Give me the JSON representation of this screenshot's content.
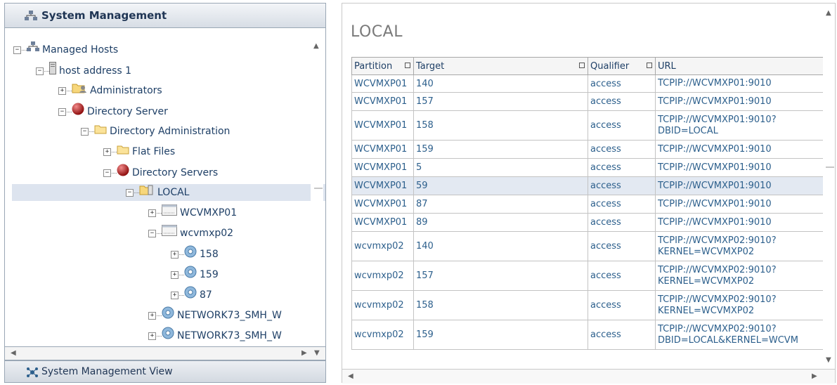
{
  "left_panel": {
    "header_title": "System Management",
    "footer_title": "System Management View",
    "tree": [
      {
        "label": "Managed Hosts",
        "icon": "hosts-icon",
        "toggle": "−"
      },
      {
        "label": "host address 1",
        "icon": "server-icon",
        "toggle": "−"
      },
      {
        "label": "Administrators",
        "icon": "admin-folder-icon",
        "toggle": "+"
      },
      {
        "label": "Directory Server",
        "icon": "red-ball-icon",
        "toggle": "−"
      },
      {
        "label": "Directory Administration",
        "icon": "folder-icon",
        "toggle": "−"
      },
      {
        "label": "Flat Files",
        "icon": "folder-icon",
        "toggle": "+"
      },
      {
        "label": "Directory Servers",
        "icon": "red-ball-icon",
        "toggle": "−"
      },
      {
        "label": "LOCAL",
        "icon": "local-folder-icon",
        "toggle": "−"
      },
      {
        "label": "WCVMXP01",
        "icon": "kernel-icon",
        "toggle": "+"
      },
      {
        "label": "wcvmxp02",
        "icon": "kernel-icon",
        "toggle": "−"
      },
      {
        "label": "158",
        "icon": "disc-icon",
        "toggle": "+"
      },
      {
        "label": "159",
        "icon": "disc-icon",
        "toggle": "+"
      },
      {
        "label": "87",
        "icon": "disc-icon",
        "toggle": "+"
      },
      {
        "label": "NETWORK73_SMH_W",
        "icon": "disc-icon",
        "toggle": "+"
      },
      {
        "label": "NETWORK73_SMH_W",
        "icon": "disc-icon",
        "toggle": "+"
      }
    ]
  },
  "right_panel": {
    "title": "LOCAL",
    "columns": [
      "Partition",
      "Target",
      "Qualifier",
      "URL"
    ],
    "rows": [
      {
        "partition": "WCVMXP01",
        "target": "140",
        "qualifier": "access",
        "url": "TCPIP://WCVMXP01:9010"
      },
      {
        "partition": "WCVMXP01",
        "target": "157",
        "qualifier": "access",
        "url": "TCPIP://WCVMXP01:9010"
      },
      {
        "partition": "WCVMXP01",
        "target": "158",
        "qualifier": "access",
        "url": "TCPIP://WCVMXP01:9010? DBID=LOCAL"
      },
      {
        "partition": "WCVMXP01",
        "target": "159",
        "qualifier": "access",
        "url": "TCPIP://WCVMXP01:9010"
      },
      {
        "partition": "WCVMXP01",
        "target": "5",
        "qualifier": "access",
        "url": "TCPIP://WCVMXP01:9010"
      },
      {
        "partition": "WCVMXP01",
        "target": "59",
        "qualifier": "access",
        "url": "TCPIP://WCVMXP01:9010"
      },
      {
        "partition": "WCVMXP01",
        "target": "87",
        "qualifier": "access",
        "url": "TCPIP://WCVMXP01:9010"
      },
      {
        "partition": "WCVMXP01",
        "target": "89",
        "qualifier": "access",
        "url": "TCPIP://WCVMXP01:9010"
      },
      {
        "partition": "wcvmxp02",
        "target": "140",
        "qualifier": "access",
        "url": "TCPIP://WCVMXP02:9010? KERNEL=WCVMXP02"
      },
      {
        "partition": "wcvmxp02",
        "target": "157",
        "qualifier": "access",
        "url": "TCPIP://WCVMXP02:9010? KERNEL=WCVMXP02"
      },
      {
        "partition": "wcvmxp02",
        "target": "158",
        "qualifier": "access",
        "url": "TCPIP://WCVMXP02:9010? KERNEL=WCVMXP02"
      },
      {
        "partition": "wcvmxp02",
        "target": "159",
        "qualifier": "access",
        "url": "TCPIP://WCVMXP02:9010? DBID=LOCAL&KERNEL=WCVM"
      }
    ]
  },
  "colors": {
    "link": "#2c5f8c",
    "selection": "#dde4ef",
    "header_text": "#1f3554"
  }
}
